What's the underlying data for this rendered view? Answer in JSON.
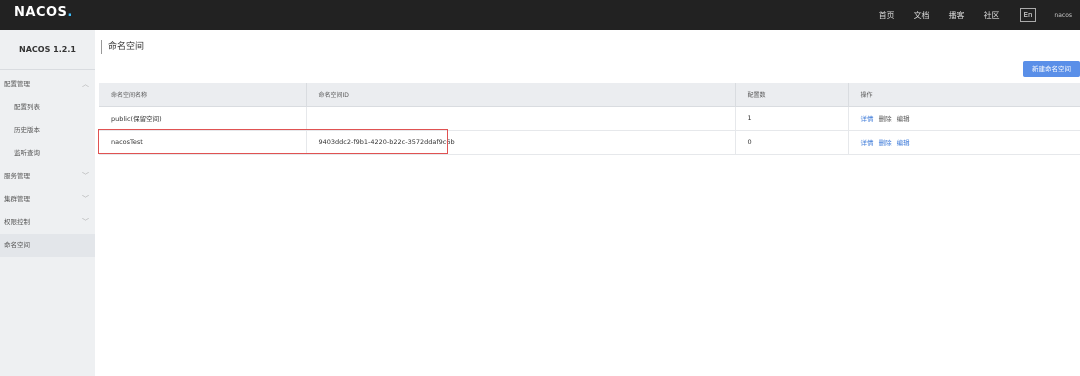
{
  "app": {
    "logo": "NACOS",
    "logo_dot": "."
  },
  "topnav": {
    "items": [
      "首页",
      "文档",
      "播客",
      "社区"
    ],
    "lang": "En",
    "user": "nacos"
  },
  "sidebar": {
    "version": "NACOS 1.2.1",
    "items": [
      {
        "label": "配置管理"
      },
      {
        "label": "配置列表"
      },
      {
        "label": "历史版本"
      },
      {
        "label": "监听查询"
      },
      {
        "label": "服务管理"
      },
      {
        "label": "集群管理"
      },
      {
        "label": "权限控制"
      },
      {
        "label": "命名空间"
      }
    ]
  },
  "main": {
    "title": "命名空间",
    "new_button": "新建命名空间",
    "table": {
      "headers": [
        "命名空间名称",
        "命名空间ID",
        "配置数",
        "操作"
      ],
      "rows": [
        {
          "name": "public(保留空间)",
          "id": "",
          "count": "1",
          "ops": [
            "详情",
            "删除",
            "编辑"
          ]
        },
        {
          "name": "nacosTest",
          "id": "9403ddc2-f9b1-4220-b22c-3572ddaf9c6b",
          "count": "0",
          "ops": [
            "详情",
            "删除",
            "编辑"
          ]
        }
      ]
    }
  },
  "colors": {
    "accent": "#5a8fe8",
    "highlight": "#e05252",
    "topbar": "#222222"
  }
}
